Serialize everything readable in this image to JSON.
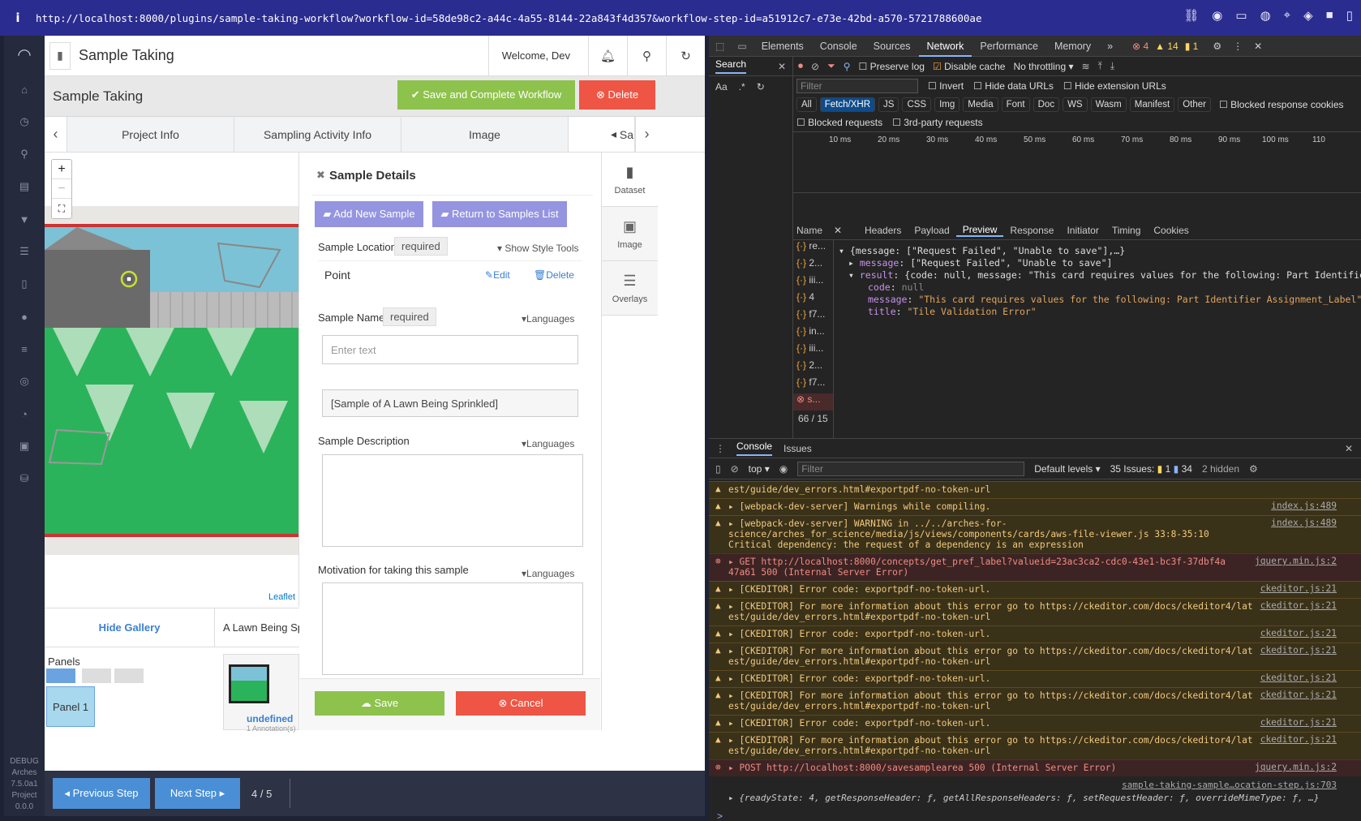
{
  "browser": {
    "url": "http://localhost:8000/plugins/sample-taking-workflow?workflow-id=58de98c2-a44c-4a55-8144-22a843f4d357&workflow-step-id=a51912c7-e73e-42bd-a570-5721788600ae",
    "info_glyph": "i"
  },
  "leftnav": {
    "debug_lines": [
      "DEBUG",
      "Arches",
      "7.5.0a1",
      "Project",
      "0.0.0"
    ]
  },
  "app": {
    "page_title": "Sample Taking",
    "welcome": "Welcome, Dev",
    "workflow_title": "Sample Taking",
    "save_complete_label": "Save and Complete Workflow",
    "delete_label": "Delete",
    "tabs": [
      "Project Info",
      "Sampling Activity Info",
      "Image",
      "Sam"
    ],
    "map": {
      "zoom_in": "+",
      "zoom_out": "−",
      "credit": "Leaflet"
    },
    "gallery": {
      "hide_label": "Hide Gallery",
      "image_name": "A Lawn Being Sp",
      "panels_label": "Panels",
      "panel_1": "Panel 1",
      "thumb_name": "undefined",
      "thumb_annotations": "1 Annotation(s)"
    },
    "details": {
      "heading": "Sample Details",
      "add_new_sample": "Add New Sample",
      "return_to_list": "Return to Samples List",
      "sample_location_label": "Sample Location",
      "required": "required",
      "show_style_tools": "Show Style Tools",
      "point_label": "Point",
      "edit_label": "Edit",
      "delete_label": "Delete",
      "sample_name_label": "Sample Name",
      "languages": "Languages",
      "name_placeholder": "Enter text",
      "name_value": "[Sample of A Lawn Being Sprinkled]",
      "description_label": "Sample Description",
      "motivation_label": "Motivation for taking this sample",
      "save_label": "Save",
      "cancel_label": "Cancel"
    },
    "side_cards": [
      {
        "label": "Dataset",
        "icon": "document-icon"
      },
      {
        "label": "Image",
        "icon": "image-icon"
      },
      {
        "label": "Overlays",
        "icon": "layers-icon"
      }
    ],
    "footer": {
      "prev_label": "Previous Step",
      "next_label": "Next Step",
      "step_counter": "4 / 5"
    }
  },
  "devtools": {
    "tabs": [
      "Elements",
      "Console",
      "Sources",
      "Network",
      "Performance",
      "Memory"
    ],
    "active_tab": "Network",
    "counts": {
      "errors": "4",
      "warnings": "14",
      "info": "1"
    },
    "search_label": "Search",
    "aa": "Aa",
    "regex": ".*",
    "preserve_log": "Preserve log",
    "disable_cache": "Disable cache",
    "throttling": "No throttling",
    "filter_placeholder": "Filter",
    "invert": "Invert",
    "hide_data_urls": "Hide data URLs",
    "hide_ext_urls": "Hide extension URLs",
    "type_chips": [
      "All",
      "Fetch/XHR",
      "JS",
      "CSS",
      "Img",
      "Media",
      "Font",
      "Doc",
      "WS",
      "Wasm",
      "Manifest",
      "Other"
    ],
    "blocked_cookies": "Blocked response cookies",
    "blocked_requests": "Blocked requests",
    "third_party": "3rd-party requests",
    "timeline_ticks": [
      "10 ms",
      "20 ms",
      "30 ms",
      "40 ms",
      "50 ms",
      "60 ms",
      "70 ms",
      "80 ms",
      "90 ms",
      "100 ms",
      "110"
    ],
    "col_name": "Name",
    "detail_tabs": [
      "Headers",
      "Payload",
      "Preview",
      "Response",
      "Initiator",
      "Timing",
      "Cookies"
    ],
    "requests": [
      "re...",
      "2...",
      "iii...",
      "4",
      "f7...",
      "in...",
      "iii...",
      "2...",
      "f7...",
      "s..."
    ],
    "request_count": "66 / 15",
    "preview": {
      "line1": "{message: [\"Request Failed\", \"Unable to save\"],…}",
      "line2_key": "message",
      "line2_val": "[\"Request Failed\", \"Unable to save\"]",
      "line3_key": "result",
      "line3_val": "{code: null, message: \"This card requires values for the following: Part Identifier",
      "code_key": "code",
      "code_val": "null",
      "msg_key": "message",
      "msg_val": "\"This card requires values for the following: Part Identifier Assignment_Label\"",
      "title_key": "title",
      "title_val": "\"Tile Validation Error\""
    },
    "console": {
      "tabs": [
        "Console",
        "Issues"
      ],
      "context": "top",
      "filter_placeholder": "Filter",
      "levels": "Default levels",
      "issues_label": "35 Issues:",
      "issues_warn": "1",
      "issues_info": "34",
      "hidden": "2 hidden",
      "logs": [
        {
          "type": "warn",
          "text": "est/guide/dev_errors.html#exportpdf-no-token-url",
          "src": ""
        },
        {
          "type": "warn",
          "text": "▸ [webpack-dev-server] Warnings while compiling.",
          "src": "index.js:489"
        },
        {
          "type": "warn",
          "text": "▸ [webpack-dev-server] WARNING in ../../arches-for-\nscience/arches_for_science/media/js/views/components/cards/aws-file-viewer.js 33:8-35:10\nCritical dependency: the request of a dependency is an expression",
          "src": "index.js:489"
        },
        {
          "type": "err",
          "text": "▸ GET http://localhost:8000/concepts/get_pref_label?valueid=23ac3ca2-cdc0-43e1-bc3f-37dbf4a\n47a61 500 (Internal Server Error)",
          "src": "jquery.min.js:2"
        },
        {
          "type": "warn",
          "text": "▸ [CKEDITOR] Error code: exportpdf-no-token-url.",
          "src": "ckeditor.js:21"
        },
        {
          "type": "warn",
          "text": "▸ [CKEDITOR] For more information about this error go to https://ckeditor.com/docs/ckeditor4/lat\nest/guide/dev_errors.html#exportpdf-no-token-url",
          "src": "ckeditor.js:21"
        },
        {
          "type": "warn",
          "text": "▸ [CKEDITOR] Error code: exportpdf-no-token-url.",
          "src": "ckeditor.js:21"
        },
        {
          "type": "warn",
          "text": "▸ [CKEDITOR] For more information about this error go to https://ckeditor.com/docs/ckeditor4/lat\nest/guide/dev_errors.html#exportpdf-no-token-url",
          "src": "ckeditor.js:21"
        },
        {
          "type": "warn",
          "text": "▸ [CKEDITOR] Error code: exportpdf-no-token-url.",
          "src": "ckeditor.js:21"
        },
        {
          "type": "warn",
          "text": "▸ [CKEDITOR] For more information about this error go to https://ckeditor.com/docs/ckeditor4/lat\nest/guide/dev_errors.html#exportpdf-no-token-url",
          "src": "ckeditor.js:21"
        },
        {
          "type": "warn",
          "text": "▸ [CKEDITOR] Error code: exportpdf-no-token-url.",
          "src": "ckeditor.js:21"
        },
        {
          "type": "warn",
          "text": "▸ [CKEDITOR] For more information about this error go to https://ckeditor.com/docs/ckeditor4/lat\nest/guide/dev_errors.html#exportpdf-no-token-url",
          "src": "ckeditor.js:21"
        },
        {
          "type": "err",
          "text": "▸ POST http://localhost:8000/savesamplearea 500 (Internal Server Error)",
          "src": "jquery.min.js:2"
        }
      ],
      "last_src": "sample-taking-sample…ocation-step.js:703",
      "last_obj": "▸ {readyState: 4, getResponseHeader: ƒ, getAllResponseHeaders: ƒ, setRequestHeader: ƒ, overrideMimeType: ƒ, …}",
      "prompt": ">"
    }
  }
}
